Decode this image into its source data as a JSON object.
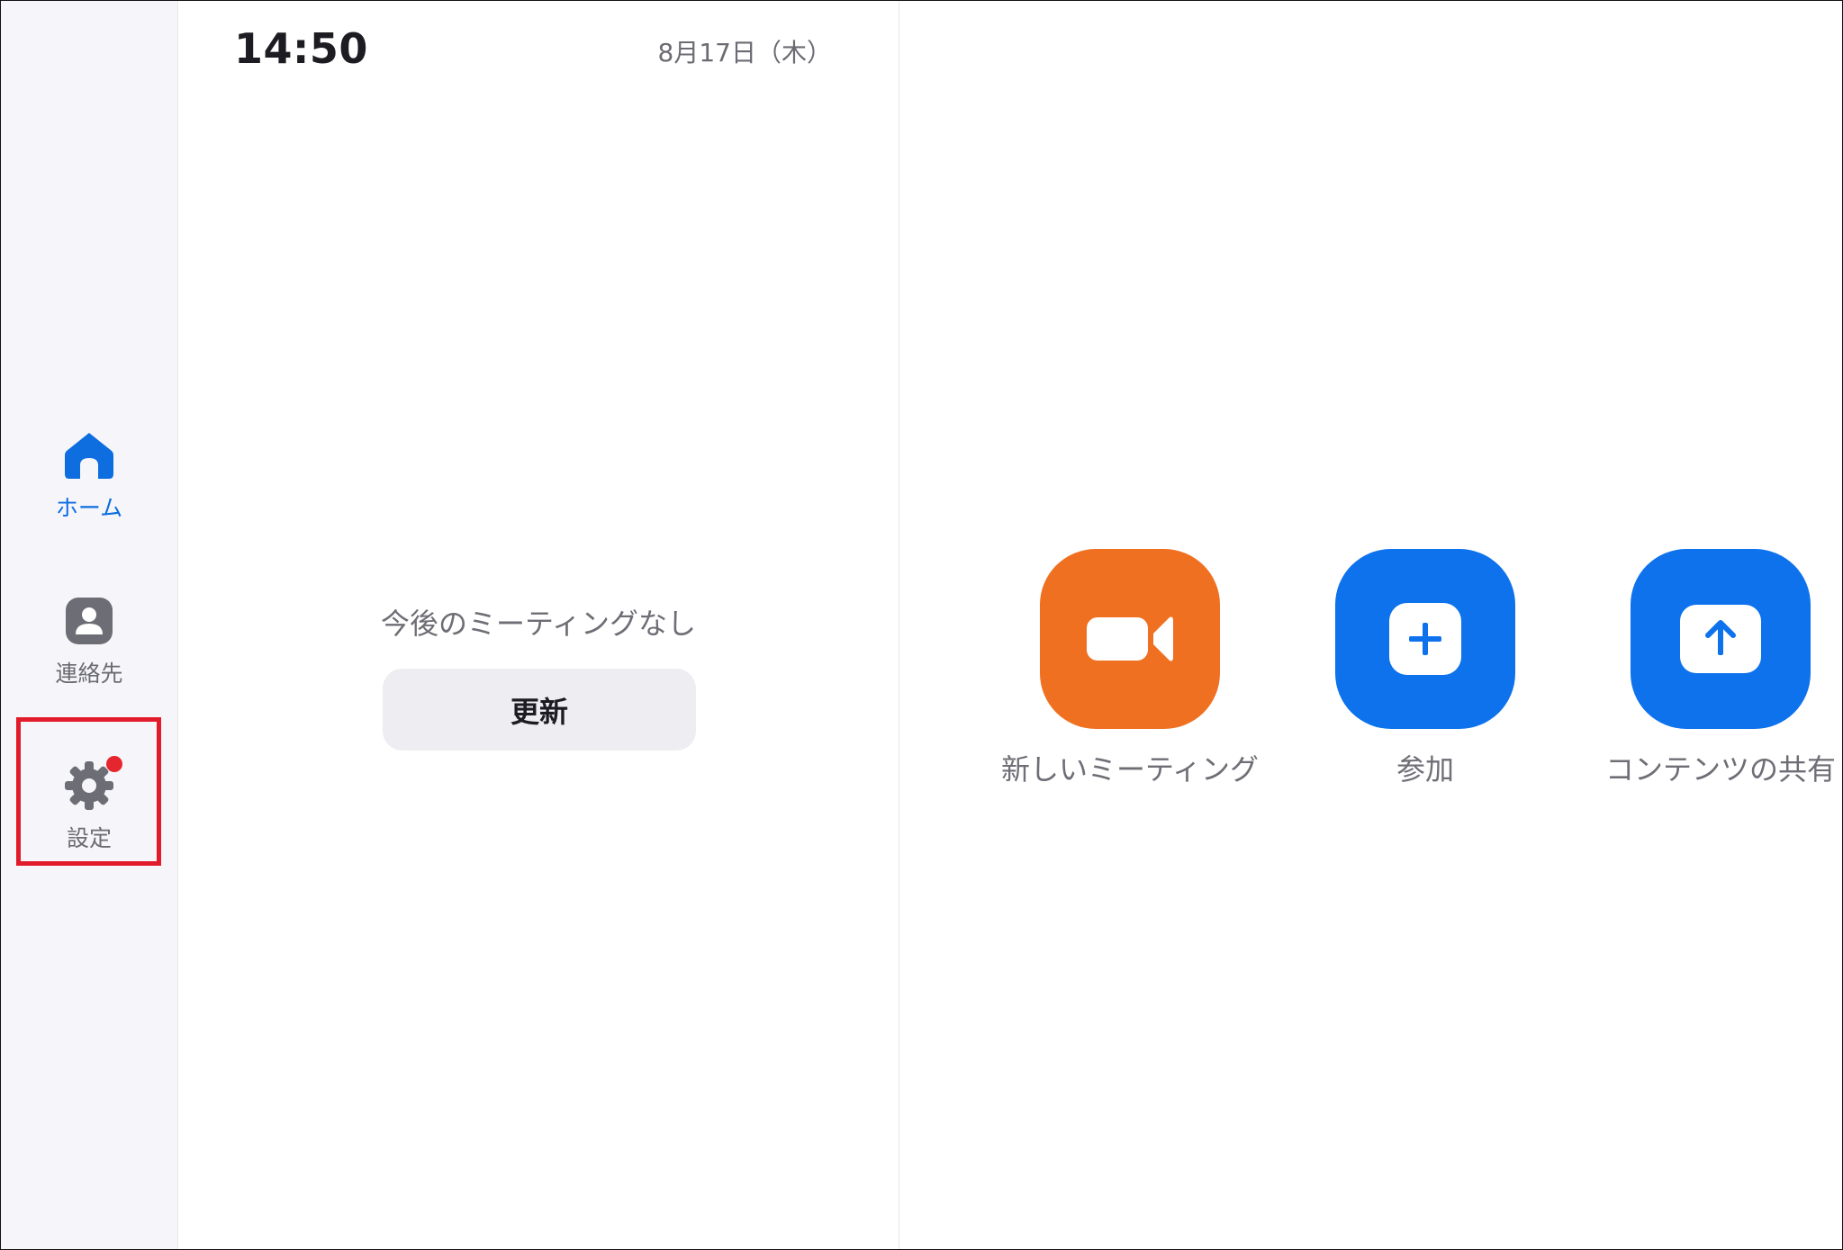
{
  "sidebar": {
    "items": [
      {
        "label": "ホーム",
        "icon": "home-icon",
        "active": true
      },
      {
        "label": "連絡先",
        "icon": "contact-icon",
        "active": false
      },
      {
        "label": "設定",
        "icon": "gear-icon",
        "active": false,
        "notification": true
      }
    ]
  },
  "header": {
    "time": "14:50",
    "date": "8月17日（木）"
  },
  "meetings": {
    "empty_text": "今後のミーティングなし",
    "refresh_label": "更新"
  },
  "actions": [
    {
      "label": "新しいミーティング",
      "icon": "video-camera-icon",
      "color": "#f07022"
    },
    {
      "label": "参加",
      "icon": "plus-icon",
      "color": "#0e72ec"
    },
    {
      "label": "コンテンツの共有",
      "icon": "share-up-arrow-icon",
      "color": "#0e72ec"
    }
  ],
  "colors": {
    "accent": "#0e6ee0",
    "highlight_box": "#e21b2a",
    "badge": "#e5262f"
  }
}
